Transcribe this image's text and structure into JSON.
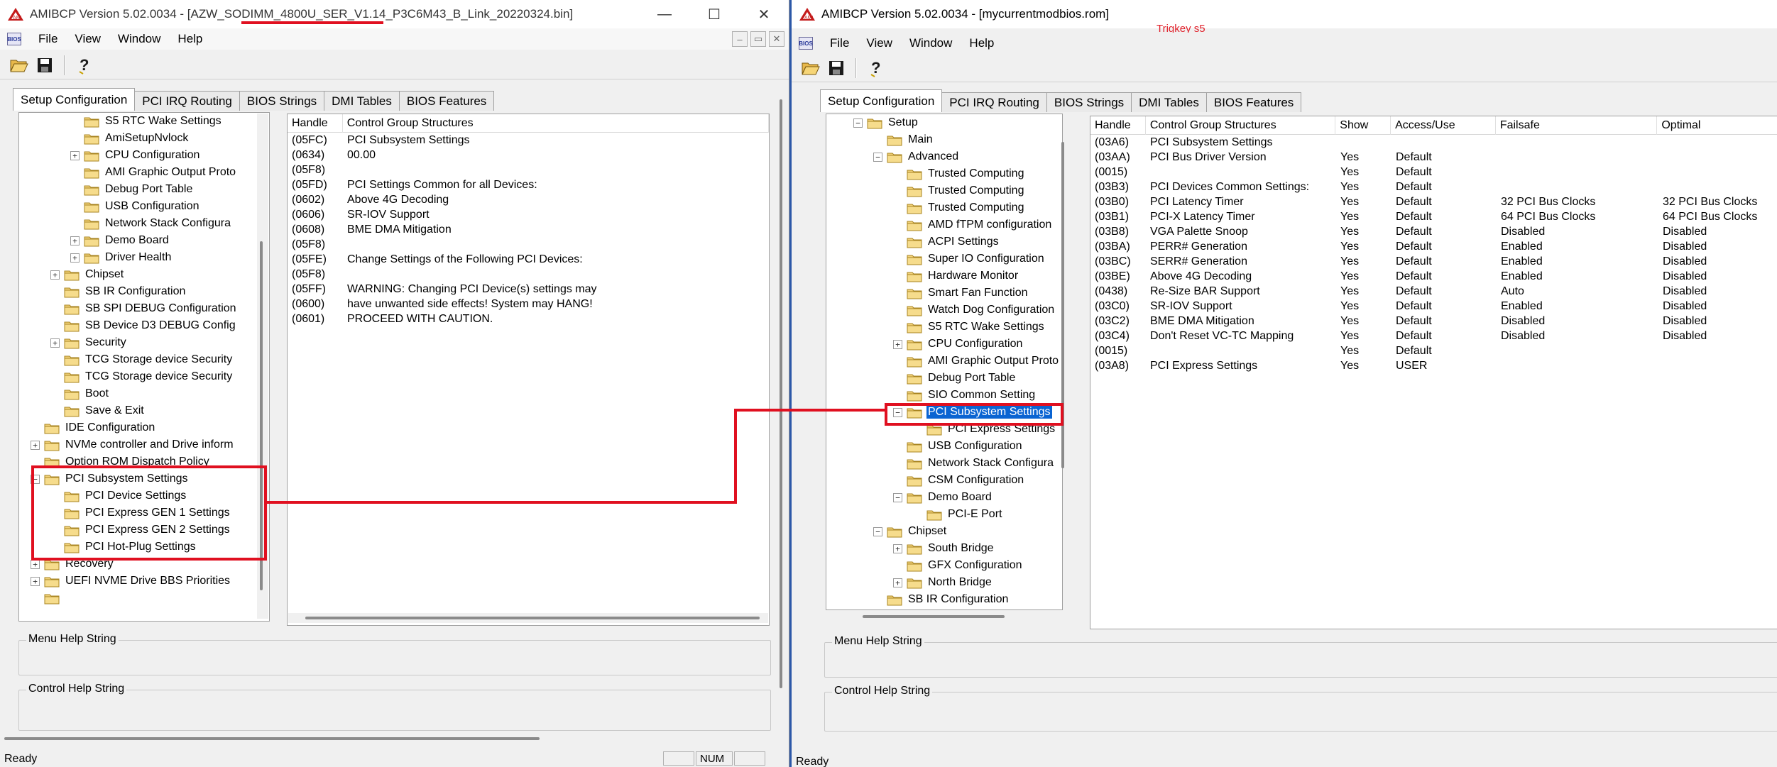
{
  "left_window": {
    "title": "AMIBCP Version 5.02.0034 - [AZW_SODIMM_4800U_SER_V1.14_P3C6M43_B_Link_20220324.bin]",
    "caption_buttons": [
      "—",
      "☐",
      "✕"
    ],
    "menu": [
      "File",
      "View",
      "Window",
      "Help"
    ],
    "mdi_buttons": [
      "–",
      "▭",
      "✕"
    ],
    "tabs": [
      "Setup Configuration",
      "PCI IRQ Routing",
      "BIOS Strings",
      "DMI Tables",
      "BIOS Features"
    ],
    "tree": [
      {
        "label": "S5 RTC Wake Settings",
        "level": 4,
        "exp": ""
      },
      {
        "label": "AmiSetupNvlock",
        "level": 4,
        "exp": ""
      },
      {
        "label": "CPU Configuration",
        "level": 4,
        "exp": "+"
      },
      {
        "label": "AMI Graphic Output Proto",
        "level": 4,
        "exp": ""
      },
      {
        "label": "Debug Port Table",
        "level": 4,
        "exp": ""
      },
      {
        "label": "USB Configuration",
        "level": 4,
        "exp": ""
      },
      {
        "label": "Network Stack Configura",
        "level": 4,
        "exp": ""
      },
      {
        "label": "Demo Board",
        "level": 4,
        "exp": "+"
      },
      {
        "label": "Driver Health",
        "level": 4,
        "exp": "+"
      },
      {
        "label": "Chipset",
        "level": 3,
        "exp": "+"
      },
      {
        "label": "SB IR Configuration",
        "level": 3,
        "exp": ""
      },
      {
        "label": "SB SPI DEBUG Configuration",
        "level": 3,
        "exp": ""
      },
      {
        "label": "SB Device D3 DEBUG Config",
        "level": 3,
        "exp": ""
      },
      {
        "label": "Security",
        "level": 3,
        "exp": "+"
      },
      {
        "label": "TCG Storage device Security",
        "level": 3,
        "exp": ""
      },
      {
        "label": "TCG Storage device Security",
        "level": 3,
        "exp": ""
      },
      {
        "label": "Boot",
        "level": 3,
        "exp": ""
      },
      {
        "label": "Save & Exit",
        "level": 3,
        "exp": ""
      },
      {
        "label": "IDE Configuration",
        "level": 2,
        "exp": ""
      },
      {
        "label": "NVMe controller and Drive inform",
        "level": 2,
        "exp": "+"
      },
      {
        "label": "Option ROM Dispatch Policy",
        "level": 2,
        "exp": ""
      },
      {
        "label": "PCI Subsystem Settings",
        "level": 2,
        "exp": "−"
      },
      {
        "label": "PCI Device Settings",
        "level": 3,
        "exp": ""
      },
      {
        "label": "PCI Express GEN 1 Settings",
        "level": 3,
        "exp": ""
      },
      {
        "label": "PCI Express GEN 2 Settings",
        "level": 3,
        "exp": ""
      },
      {
        "label": "PCI Hot-Plug Settings",
        "level": 3,
        "exp": ""
      },
      {
        "label": "Recovery",
        "level": 2,
        "exp": "+"
      },
      {
        "label": "UEFI NVME Drive BBS Priorities",
        "level": 2,
        "exp": "+"
      },
      {
        "label": "",
        "level": 2,
        "exp": ""
      }
    ],
    "list_headers": [
      "Handle",
      "Control Group Structures"
    ],
    "list_rows": [
      [
        "(05FC)",
        "PCI Subsystem Settings"
      ],
      [
        "(0634)",
        "00.00"
      ],
      [
        "(05F8)",
        ""
      ],
      [
        "(05FD)",
        "PCI Settings Common for all Devices:"
      ],
      [
        "(0602)",
        "Above 4G Decoding"
      ],
      [
        "(0606)",
        "SR-IOV Support"
      ],
      [
        "(0608)",
        "BME DMA Mitigation"
      ],
      [
        "(05F8)",
        ""
      ],
      [
        "(05FE)",
        "Change Settings of the Following PCI Devices:"
      ],
      [
        "(05F8)",
        ""
      ],
      [
        "(05FF)",
        "WARNING: Changing PCI Device(s) settings may"
      ],
      [
        "(0600)",
        "have unwanted side effects! System may HANG!"
      ],
      [
        "(0601)",
        "PROCEED WITH CAUTION."
      ]
    ],
    "menu_help_label": "Menu Help String",
    "control_help_label": "Control Help String",
    "status": "Ready",
    "status_pane": "NUM"
  },
  "right_window": {
    "title": "AMIBCP Version 5.02.0034 - [mycurrentmodbios.rom]",
    "annotation": "Trigkey  s5",
    "menu": [
      "File",
      "View",
      "Window",
      "Help"
    ],
    "tabs": [
      "Setup Configuration",
      "PCI IRQ Routing",
      "BIOS Strings",
      "DMI Tables",
      "BIOS Features"
    ],
    "tree": [
      {
        "label": "Setup",
        "level": 1,
        "exp": "−"
      },
      {
        "label": "Main",
        "level": 2,
        "exp": ""
      },
      {
        "label": "Advanced",
        "level": 2,
        "exp": "−"
      },
      {
        "label": "Trusted Computing",
        "level": 3,
        "exp": ""
      },
      {
        "label": "Trusted Computing",
        "level": 3,
        "exp": ""
      },
      {
        "label": "Trusted Computing",
        "level": 3,
        "exp": ""
      },
      {
        "label": "AMD fTPM configuration",
        "level": 3,
        "exp": ""
      },
      {
        "label": "ACPI Settings",
        "level": 3,
        "exp": ""
      },
      {
        "label": "Super IO Configuration",
        "level": 3,
        "exp": ""
      },
      {
        "label": "Hardware Monitor",
        "level": 3,
        "exp": ""
      },
      {
        "label": "Smart Fan Function",
        "level": 3,
        "exp": ""
      },
      {
        "label": "Watch Dog Configuration",
        "level": 3,
        "exp": ""
      },
      {
        "label": "S5 RTC Wake Settings",
        "level": 3,
        "exp": ""
      },
      {
        "label": "CPU Configuration",
        "level": 3,
        "exp": "+"
      },
      {
        "label": "AMI Graphic Output Proto",
        "level": 3,
        "exp": ""
      },
      {
        "label": "Debug Port Table",
        "level": 3,
        "exp": ""
      },
      {
        "label": "SIO Common Setting",
        "level": 3,
        "exp": ""
      },
      {
        "label": "PCI Subsystem Settings",
        "level": 3,
        "exp": "−",
        "selected": true
      },
      {
        "label": "PCI Express Settings",
        "level": 4,
        "exp": ""
      },
      {
        "label": "USB Configuration",
        "level": 3,
        "exp": ""
      },
      {
        "label": "Network Stack Configura",
        "level": 3,
        "exp": ""
      },
      {
        "label": "CSM Configuration",
        "level": 3,
        "exp": ""
      },
      {
        "label": "Demo Board",
        "level": 3,
        "exp": "−"
      },
      {
        "label": "PCI-E Port",
        "level": 4,
        "exp": ""
      },
      {
        "label": "Chipset",
        "level": 2,
        "exp": "−"
      },
      {
        "label": "South Bridge",
        "level": 3,
        "exp": "+"
      },
      {
        "label": "GFX Configuration",
        "level": 3,
        "exp": ""
      },
      {
        "label": "North Bridge",
        "level": 3,
        "exp": "+"
      },
      {
        "label": "SB IR Configuration",
        "level": 2,
        "exp": ""
      }
    ],
    "list_headers": [
      "Handle",
      "Control Group Structures",
      "Show",
      "Access/Use",
      "Failsafe",
      "Optimal"
    ],
    "list_rows": [
      [
        "(03A6)",
        "PCI Subsystem Settings",
        "",
        "",
        "",
        ""
      ],
      [
        "(03AA)",
        "PCI Bus Driver Version",
        "Yes",
        "Default",
        "",
        ""
      ],
      [
        "(0015)",
        "",
        "Yes",
        "Default",
        "",
        ""
      ],
      [
        "(03B3)",
        "PCI Devices Common Settings:",
        "Yes",
        "Default",
        "",
        ""
      ],
      [
        "(03B0)",
        "PCI Latency Timer",
        "Yes",
        "Default",
        "32 PCI Bus Clocks",
        "32 PCI Bus Clocks"
      ],
      [
        "(03B1)",
        "PCI-X Latency Timer",
        "Yes",
        "Default",
        "64 PCI Bus Clocks",
        "64 PCI Bus Clocks"
      ],
      [
        "(03B8)",
        "VGA Palette Snoop",
        "Yes",
        "Default",
        "Disabled",
        "Disabled"
      ],
      [
        "(03BA)",
        "PERR# Generation",
        "Yes",
        "Default",
        "Enabled",
        "Disabled"
      ],
      [
        "(03BC)",
        "SERR# Generation",
        "Yes",
        "Default",
        "Enabled",
        "Disabled"
      ],
      [
        "(03BE)",
        "Above 4G Decoding",
        "Yes",
        "Default",
        "Enabled",
        "Disabled"
      ],
      [
        "(0438)",
        "Re-Size BAR Support",
        "Yes",
        "Default",
        "Auto",
        "Disabled"
      ],
      [
        "(03C0)",
        "SR-IOV Support",
        "Yes",
        "Default",
        "Enabled",
        "Disabled"
      ],
      [
        "(03C2)",
        "BME DMA Mitigation",
        "Yes",
        "Default",
        "Disabled",
        "Disabled"
      ],
      [
        "(03C4)",
        "Don't Reset VC-TC Mapping",
        "Yes",
        "Default",
        "Disabled",
        "Disabled"
      ],
      [
        "(0015)",
        "",
        "Yes",
        "Default",
        "",
        ""
      ],
      [
        "(03A8)",
        "PCI Express Settings",
        "Yes",
        "USER",
        "",
        ""
      ]
    ],
    "menu_help_label": "Menu Help String",
    "control_help_label": "Control Help String",
    "status": "Ready"
  },
  "colors": {
    "annotation_red": "#e01020",
    "selection_blue": "#0a64d2",
    "folder_yellow": "#f2d27a"
  },
  "icons": [
    "app-logo-icon",
    "open-folder-icon",
    "save-icon",
    "help-icon",
    "folder-icon"
  ]
}
